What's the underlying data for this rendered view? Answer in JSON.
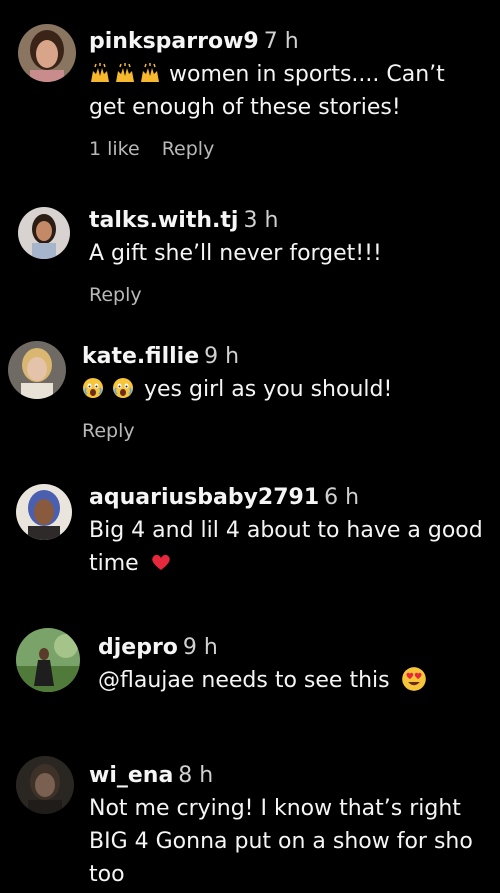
{
  "comments": [
    {
      "username": "pinksparrow9",
      "time": "7 h",
      "emoji_prefix": [
        "raising-hands-icon",
        "raising-hands-icon",
        "raising-hands-icon"
      ],
      "text_line1": "women in sports.... Can’t",
      "text_line2": "get enough of these stories!",
      "likes": "1 like",
      "reply": "Reply"
    },
    {
      "username": "talks.with.tj",
      "time": "3 h",
      "text_line1": "A gift she’ll never forget!!!",
      "reply": "Reply"
    },
    {
      "username": "kate.fillie",
      "time": "9 h",
      "emoji_prefix": [
        "face-screaming-icon",
        "face-screaming-icon"
      ],
      "text_line1": "yes girl as you should!",
      "reply": "Reply"
    },
    {
      "username": "aquariusbaby2791",
      "time": "6 h",
      "text_line1": "Big 4 and lil 4 about to have a good",
      "text_line2": "time",
      "emoji_suffix": "red-heart-icon"
    },
    {
      "username": "djepro",
      "time": "9 h",
      "text_line1": "@flaujae needs to see this",
      "emoji_suffix": "smiling-heart-eyes-icon"
    },
    {
      "username": "wi_ena",
      "time": "8 h",
      "text_line1": "Not me crying! I know that’s right",
      "text_line2": "BIG 4 Gonna put on a show for sho",
      "text_line3": "too"
    }
  ],
  "colors": {
    "background": "#000000",
    "text": "#f5f5f5",
    "secondary": "#b9b9b9"
  }
}
